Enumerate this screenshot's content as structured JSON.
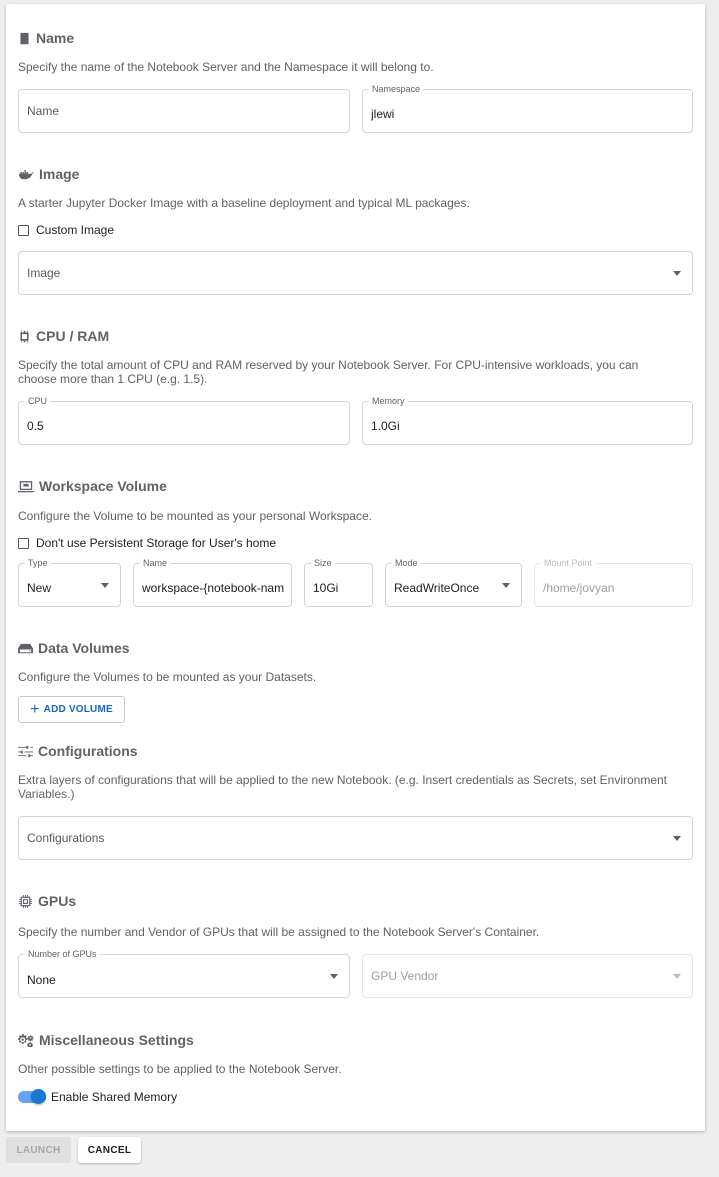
{
  "sections": {
    "name": {
      "title": "Name",
      "icon": "book-icon",
      "description": "Specify the name of the Notebook Server and the Namespace it will belong to.",
      "name_field": {
        "placeholder": "Name",
        "value": ""
      },
      "namespace_field": {
        "label": "Namespace",
        "value": "jlewi"
      }
    },
    "image": {
      "title": "Image",
      "icon": "docker-icon",
      "description": "A starter Jupyter Docker Image with a baseline deployment and typical ML packages.",
      "custom_image_label": "Custom Image",
      "custom_image_checked": false,
      "image_select": {
        "placeholder": "Image",
        "value": ""
      }
    },
    "cpu_ram": {
      "title": "CPU / RAM",
      "icon": "chip-icon",
      "description": "Specify the total amount of CPU and RAM reserved by your Notebook Server. For CPU-intensive workloads, you can choose more than 1 CPU (e.g. 1.5).",
      "cpu": {
        "label": "CPU",
        "value": "0.5"
      },
      "memory": {
        "label": "Memory",
        "value": "1.0Gi"
      }
    },
    "workspace": {
      "title": "Workspace Volume",
      "icon": "laptop-icon",
      "description": "Configure the Volume to be mounted as your personal Workspace.",
      "no_persistent_label": "Don't use Persistent Storage for User's home",
      "no_persistent_checked": false,
      "type": {
        "label": "Type",
        "value": "New"
      },
      "name": {
        "label": "Name",
        "value": "workspace-{notebook-name}"
      },
      "size": {
        "label": "Size",
        "value": "10Gi"
      },
      "mode": {
        "label": "Mode",
        "value": "ReadWriteOnce"
      },
      "mount_point": {
        "label": "Mount Point",
        "value": "/home/jovyan"
      }
    },
    "data_volumes": {
      "title": "Data Volumes",
      "icon": "storage-icon",
      "description": "Configure the Volumes to be mounted as your Datasets.",
      "add_button": "ADD VOLUME"
    },
    "configurations": {
      "title": "Configurations",
      "icon": "tune-icon",
      "description": "Extra layers of configurations that will be applied to the new Notebook. (e.g. Insert credentials as Secrets, set Environment Variables.)",
      "select": {
        "placeholder": "Configurations",
        "value": ""
      }
    },
    "gpus": {
      "title": "GPUs",
      "icon": "gpu-chip-icon",
      "description": "Specify the number and Vendor of GPUs that will be assigned to the Notebook Server's Container.",
      "number": {
        "label": "Number of GPUs",
        "value": "None"
      },
      "vendor": {
        "placeholder": "GPU Vendor",
        "value": ""
      }
    },
    "misc": {
      "title": "Miscellaneous Settings",
      "icon": "gears-icon",
      "description": "Other possible settings to be applied to the Notebook Server.",
      "shared_memory_label": "Enable Shared Memory",
      "shared_memory_enabled": true
    }
  },
  "footer": {
    "launch": "LAUNCH",
    "cancel": "CANCEL"
  },
  "colors": {
    "accent": "#1976d2",
    "section_title": "#5f6368",
    "background": "#eeeeee"
  }
}
